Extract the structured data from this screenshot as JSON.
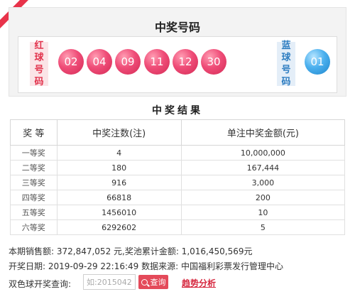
{
  "draw": {
    "title": "中奖号码",
    "red_label": [
      "红",
      "球",
      "号",
      "码"
    ],
    "blue_label": [
      "蓝",
      "球",
      "号",
      "码"
    ],
    "red_balls": [
      "02",
      "04",
      "09",
      "11",
      "12",
      "30"
    ],
    "blue_ball": "01"
  },
  "results": {
    "title": "中奖结果",
    "headers": [
      "奖 等",
      "中奖注数(注)",
      "单注中奖金额(元)"
    ],
    "rows": [
      {
        "level": "一等奖",
        "count": "4",
        "amount": "10,000,000"
      },
      {
        "level": "二等奖",
        "count": "180",
        "amount": "167,444"
      },
      {
        "level": "三等奖",
        "count": "916",
        "amount": "3,000"
      },
      {
        "level": "四等奖",
        "count": "66818",
        "amount": "200"
      },
      {
        "level": "五等奖",
        "count": "1456010",
        "amount": "10"
      },
      {
        "level": "六等奖",
        "count": "6292602",
        "amount": "5"
      }
    ]
  },
  "info": {
    "sales_line": "本期销售额: 372,847,052 元,奖池累计金额: 1,016,450,569元",
    "date_line": "开奖日期: 2019-09-29 22:16:49 数据来源: 中国福利彩票发行管理中心"
  },
  "query": {
    "label": "双色球开奖查询:",
    "placeholder": "如:2015042",
    "button": "查询",
    "trend_link": "趋势分析"
  },
  "colors": {
    "accent_red": "#e8334a",
    "red_ball": "#e2456d",
    "blue_ball": "#3a9fe0"
  }
}
